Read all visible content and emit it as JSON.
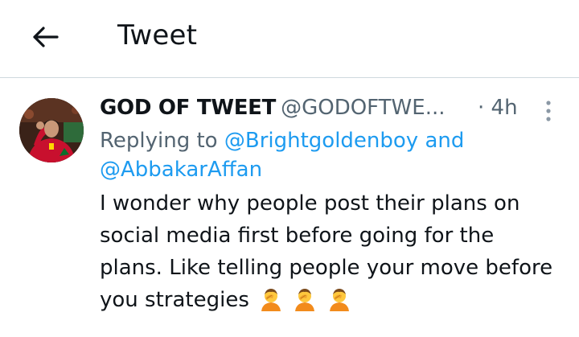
{
  "header": {
    "title": "Tweet",
    "back_icon": "arrow-left-icon"
  },
  "tweet": {
    "author_name": "GOD OF TWEET",
    "author_handle": "@GODOFTWE...",
    "timestamp": "· 4h",
    "more_icon": "more-vertical-icon",
    "replying_prefix": "Replying to",
    "reply_to_1": "@Brightgoldenboy",
    "reply_joiner": "and",
    "reply_to_2": "@AbbakarAffan",
    "text": "I wonder why people post their plans on social media first before going for the plans. Like telling people your move before you strategies",
    "emojis": [
      "person-facepalming",
      "person-facepalming",
      "person-facepalming"
    ]
  },
  "colors": {
    "link": "#1d9bf0",
    "secondary_text": "#536471",
    "primary_text": "#0f1419",
    "divider": "#cfd9de"
  }
}
